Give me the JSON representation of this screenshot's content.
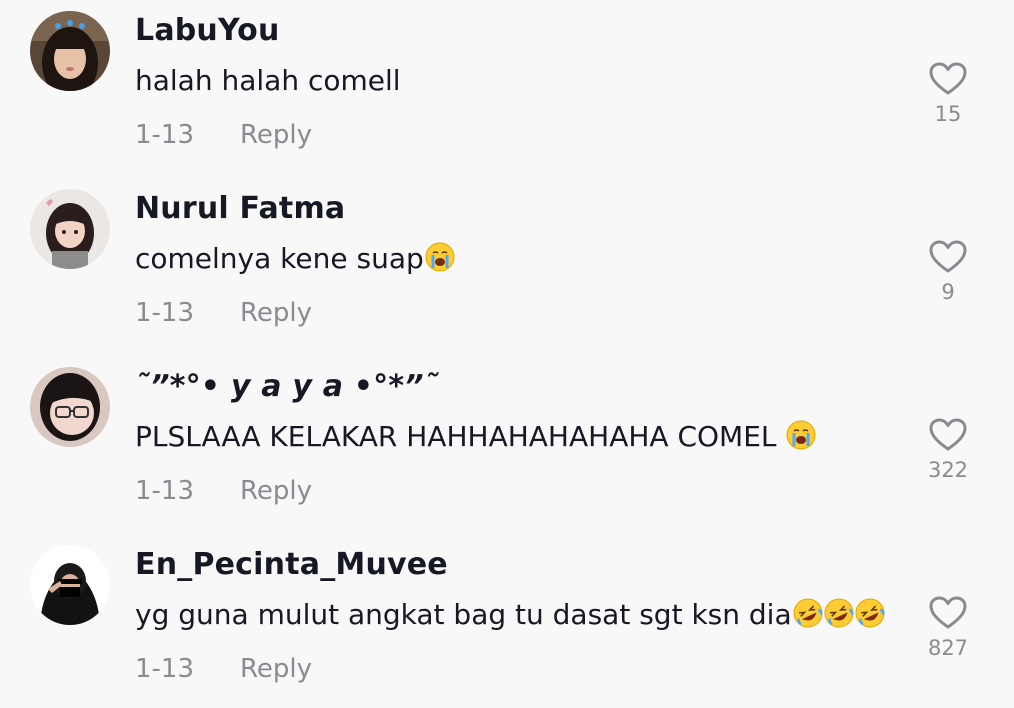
{
  "comments": [
    {
      "username": "LabuYou",
      "text": "halah halah comell",
      "emojis": [],
      "date": "1-13",
      "reply_label": "Reply",
      "likes": "15",
      "avatar_palette": {
        "bg": "#5a4636",
        "face": "#e8c2a8",
        "hair": "#1e1511",
        "accent": "#48a0e8"
      }
    },
    {
      "username": "Nurul Fatma",
      "text": "comelnya kene suap",
      "emojis": [
        "crying-face"
      ],
      "date": "1-13",
      "reply_label": "Reply",
      "likes": "9",
      "avatar_palette": {
        "bg": "#ebe7e4",
        "face": "#f3d4c4",
        "hair": "#2a1d1d",
        "accent": "#e79aa6"
      }
    },
    {
      "username": "˜”*°• y a y a •°*”˜",
      "text": "PLSLAAA KELAKAR HAHHAHAHAHAHA COMEL ",
      "emojis": [
        "crying-face"
      ],
      "date": "1-13",
      "reply_label": "Reply",
      "likes": "322",
      "avatar_palette": {
        "bg": "#d9c8c2",
        "face": "#f1d7cd",
        "hair": "#1a1414",
        "accent": "#333333"
      }
    },
    {
      "username": "En_Pecinta_Muvee",
      "text": "yg guna mulut angkat bag tu dasat sgt ksn dia",
      "emojis": [
        "rofl-face",
        "rofl-face",
        "rofl-face"
      ],
      "date": "1-13",
      "reply_label": "Reply",
      "likes": "827",
      "avatar_palette": {
        "bg": "#ffffff",
        "face": "#d9b49b",
        "hair": "#121212",
        "accent": "#000000"
      }
    }
  ],
  "colors": {
    "background": "#f8f8f8",
    "username": "#161823",
    "secondary_text": "#8a8b91"
  }
}
